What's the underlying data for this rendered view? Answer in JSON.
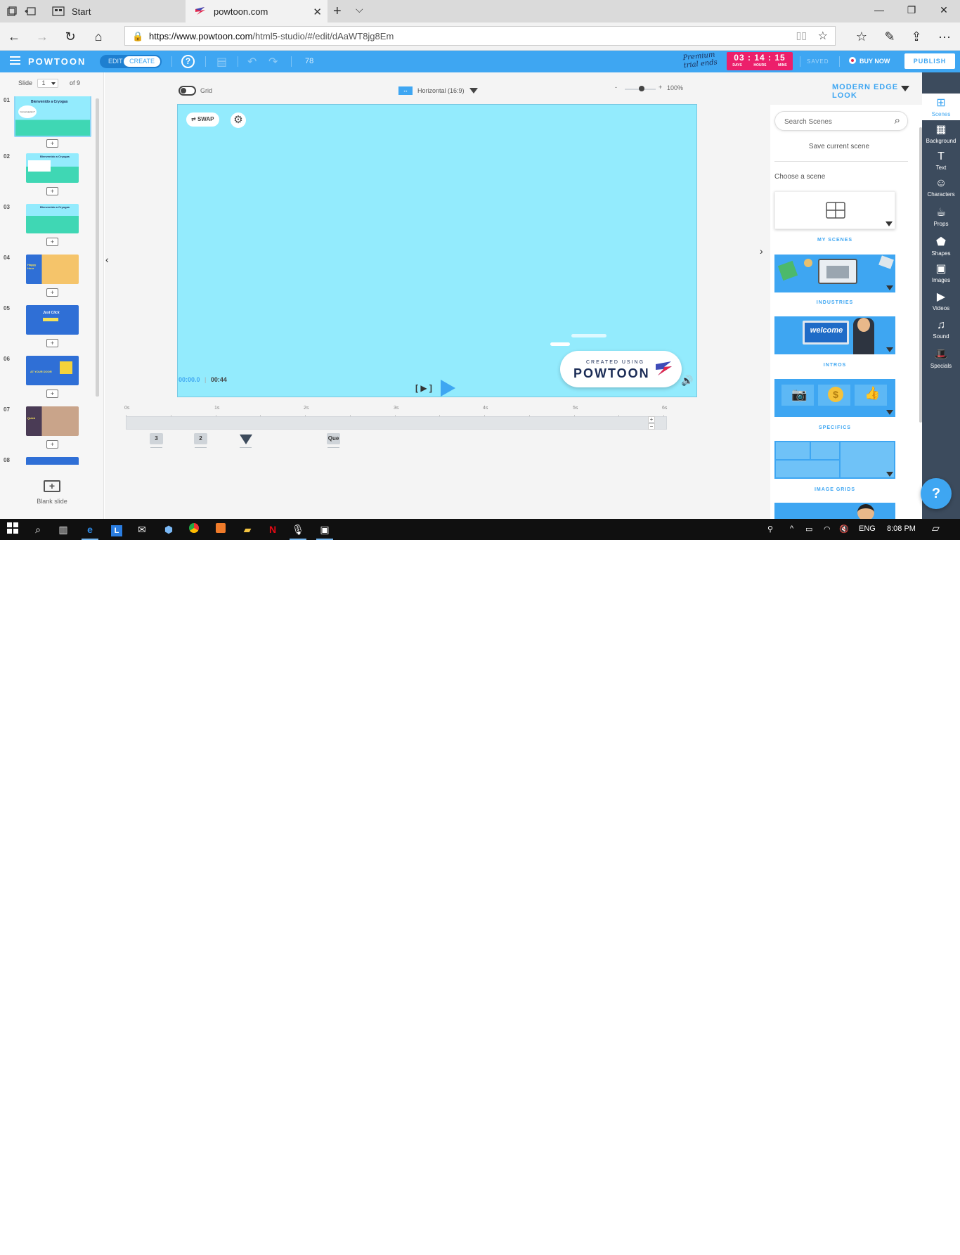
{
  "browser": {
    "tabs": [
      {
        "label": "Start"
      },
      {
        "label": "powtoon.com",
        "close": "✕"
      }
    ],
    "new_tab": "+",
    "tab_list": "⌵",
    "window_controls": {
      "minimize": "—",
      "restore": "❐",
      "close": "✕"
    },
    "nav": {
      "back": "←",
      "forward": "→",
      "refresh": "↻",
      "home": "⌂"
    },
    "url_host": "https://www.powtoon.com",
    "url_path": "/html5-studio/#/edit/dAaWT8jg8Em",
    "toolbar_icons": [
      "favorites-icon",
      "pen-icon",
      "share-icon",
      "more-icon"
    ],
    "more": "···"
  },
  "app": {
    "logo": "POWTOON",
    "mode": {
      "edit": "EDIT",
      "create": "CREATE"
    },
    "help": "?",
    "count": "78",
    "trial_text_line1": "Premium",
    "trial_text_line2": "trial ends",
    "timer": {
      "days": "03",
      "hours": "14",
      "mins": "15",
      "sep": ":",
      "days_label": "DAYS",
      "hours_label": "HOURS",
      "mins_label": "MINS"
    },
    "saved": "SAVED",
    "buy_now": "BUY NOW",
    "publish": "PUBLISH",
    "accent": "#3ea6f2",
    "timer_color": "#ec1f6b"
  },
  "slides": {
    "label": "Slide",
    "current": "1",
    "of": "of 9",
    "items": [
      {
        "num": "01",
        "title": "Bienvenido a Cryogas",
        "bubble": "Conversaption?"
      },
      {
        "num": "02",
        "title": "Bienvenido a Cryogas"
      },
      {
        "num": "03",
        "title": "Bienvenido a Cryogas"
      },
      {
        "num": "04",
        "title": "Happy Hour"
      },
      {
        "num": "05",
        "title": "Just Click"
      },
      {
        "num": "06",
        "title": "AT YOUR DOOR"
      },
      {
        "num": "07",
        "title": "Quick"
      },
      {
        "num": "08",
        "title": ""
      }
    ],
    "blank_slide": "Blank slide"
  },
  "stage": {
    "grid_label": "Grid",
    "aspect_label": "Horizontal (16:9)",
    "zoom_minus": "-",
    "zoom_plus": "+",
    "zoom_pct": "100%",
    "zoom_value": 0.55,
    "swap_label": "SWAP",
    "badge_top": "CREATED USING",
    "badge_brand": "POWTOON",
    "canvas_color": "#93ebfd",
    "time_current": "00:00.0",
    "time_sep": "|",
    "time_total": "00:44",
    "bracket_play": "[ ▶ ]",
    "timeline_labels": [
      "0s",
      "1s",
      "2s",
      "3s",
      "4s",
      "5s",
      "6s"
    ],
    "track_plus": "+",
    "track_minus": "−",
    "markers": [
      "3",
      "2",
      "",
      "Que"
    ]
  },
  "right": {
    "look_title": "MODERN EDGE LOOK",
    "search_placeholder": "Search Scenes",
    "save_scene": "Save current scene",
    "choose_scene": "Choose a scene",
    "categories": [
      "MY SCENES",
      "INDUSTRIES",
      "INTROS",
      "SPECIFICS",
      "IMAGE GRIDS"
    ],
    "welcome_text": "welcome"
  },
  "rail": [
    {
      "label": "Scenes",
      "icon": "scenes-icon",
      "glyph": "⊞"
    },
    {
      "label": "Background",
      "icon": "background-icon",
      "glyph": "▦"
    },
    {
      "label": "Text",
      "icon": "text-icon",
      "glyph": "T"
    },
    {
      "label": "Characters",
      "icon": "characters-icon",
      "glyph": "☺"
    },
    {
      "label": "Props",
      "icon": "props-icon",
      "glyph": "☕"
    },
    {
      "label": "Shapes",
      "icon": "shapes-icon",
      "glyph": "⬟"
    },
    {
      "label": "Images",
      "icon": "images-icon",
      "glyph": "▣"
    },
    {
      "label": "Videos",
      "icon": "videos-icon",
      "glyph": "▶"
    },
    {
      "label": "Sound",
      "icon": "sound-icon",
      "glyph": "♫"
    },
    {
      "label": "Specials",
      "icon": "specials-icon",
      "glyph": "🎩"
    }
  ],
  "help_fab": "?",
  "taskbar": {
    "lang": "ENG",
    "time": "8:08 PM"
  }
}
